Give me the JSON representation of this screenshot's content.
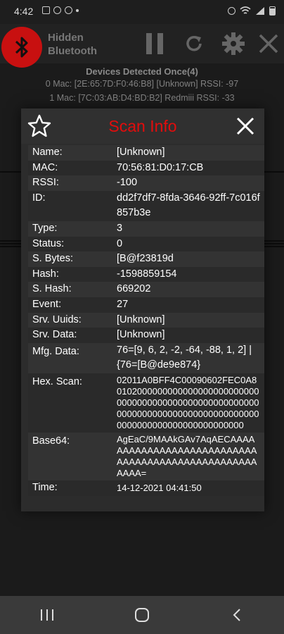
{
  "status_bar": {
    "time": "4:42"
  },
  "app": {
    "title_line1": "Hidden",
    "title_line2": "Bluetooth",
    "accent": "#e30c0c",
    "logo_color": "#c81010"
  },
  "background": {
    "heading": "Devices Detected Once(4)",
    "lines": [
      "0 Mac: [2E:65:7D:F0:46:B8] [Unknown] RSSI: -97",
      "1 Mac: [7C:03:AB:D4:BD:B2] Redmiii RSSI: -33"
    ]
  },
  "dialog": {
    "title": "Scan Info",
    "rows": [
      {
        "key": "Name:",
        "value": "[Unknown]"
      },
      {
        "key": "MAC:",
        "value": "70:56:81:D0:17:CB"
      },
      {
        "key": "RSSI:",
        "value": "-100"
      },
      {
        "key": "ID:",
        "value": "dd2f7df7-8fda-3646-92ff-7c016f857b3e"
      },
      {
        "key": "Type:",
        "value": "3"
      },
      {
        "key": "Status:",
        "value": "0"
      },
      {
        "key": "S. Bytes:",
        "value": "[B@f23819d"
      },
      {
        "key": "Hash:",
        "value": "-1598859154"
      },
      {
        "key": "S. Hash:",
        "value": "669202"
      },
      {
        "key": "Event:",
        "value": "27"
      },
      {
        "key": "Srv. Uuids:",
        "value": "[Unknown]"
      },
      {
        "key": "Srv. Data:",
        "value": "[Unknown]"
      },
      {
        "key": "Mfg. Data:",
        "value": "76=[9, 6, 2, -2, -64, -88, 1, 2] | {76=[B@de9e874}"
      },
      {
        "key": "Hex. Scan:",
        "value": "02011A0BFF4C00090602FEC0A80102000000000000000000000000000000000000000000000000000000000000000000000000000000000000000000000000000000000"
      },
      {
        "key": "Base64:",
        "value": "AgEaC/9MAAkGAv7AqAECAAAAAAAAAAAAAAAAAAAAAAAAAAAAAAAAAAAAAAAAAAAAAAAAAAAAAA="
      },
      {
        "key": "Time:",
        "value": "14-12-2021 04:41:50"
      }
    ]
  },
  "icons": {
    "star": "star-outline-icon",
    "close": "close-icon",
    "pause": "pause-icon",
    "refresh": "refresh-icon",
    "settings": "gear-icon",
    "exit": "close-icon",
    "bluetooth": "bluetooth-icon"
  }
}
